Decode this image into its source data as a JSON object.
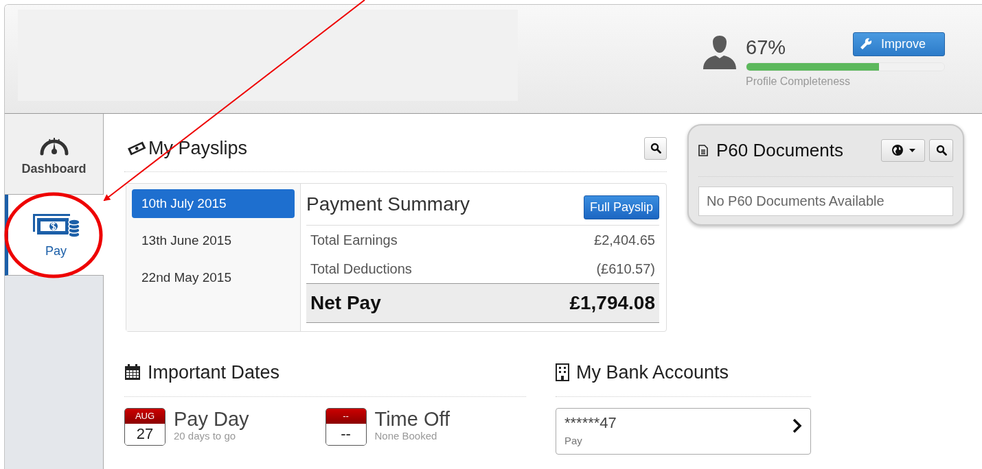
{
  "profile": {
    "percent": "67%",
    "level": 0.67,
    "caption": "Profile Completeness",
    "button": "Improve"
  },
  "sidebar": {
    "items": [
      {
        "label": "Dashboard",
        "kind": "gauge",
        "selected": false
      },
      {
        "label": "Pay",
        "kind": "money",
        "selected": true
      }
    ]
  },
  "payslips": {
    "title": "My Payslips",
    "dates": [
      {
        "label": "10th July 2015",
        "selected": true
      },
      {
        "label": "13th June 2015",
        "selected": false
      },
      {
        "label": "22nd May 2015",
        "selected": false
      }
    ],
    "summary": {
      "title": "Payment Summary",
      "button": "Full Payslip",
      "rows": [
        {
          "label": "Total Earnings",
          "value": "£2,404.65",
          "kind": "line"
        },
        {
          "label": "Total Deductions",
          "value": "(£610.57)",
          "kind": "line"
        },
        {
          "label": "Net Pay",
          "value": "£1,794.08",
          "kind": "total"
        }
      ]
    }
  },
  "p60": {
    "title": "P60 Documents",
    "message": "No P60 Documents Available"
  },
  "important_dates": {
    "title": "Important Dates",
    "items": [
      {
        "month": "AUG",
        "day": "27",
        "title": "Pay Day",
        "subtitle": "20 days to go"
      },
      {
        "month": "--",
        "day": "--",
        "title": "Time Off",
        "subtitle": "None Booked"
      }
    ]
  },
  "bank_accounts": {
    "title": "My Bank Accounts",
    "accounts": [
      {
        "number": "******47",
        "type": "Pay"
      }
    ]
  }
}
